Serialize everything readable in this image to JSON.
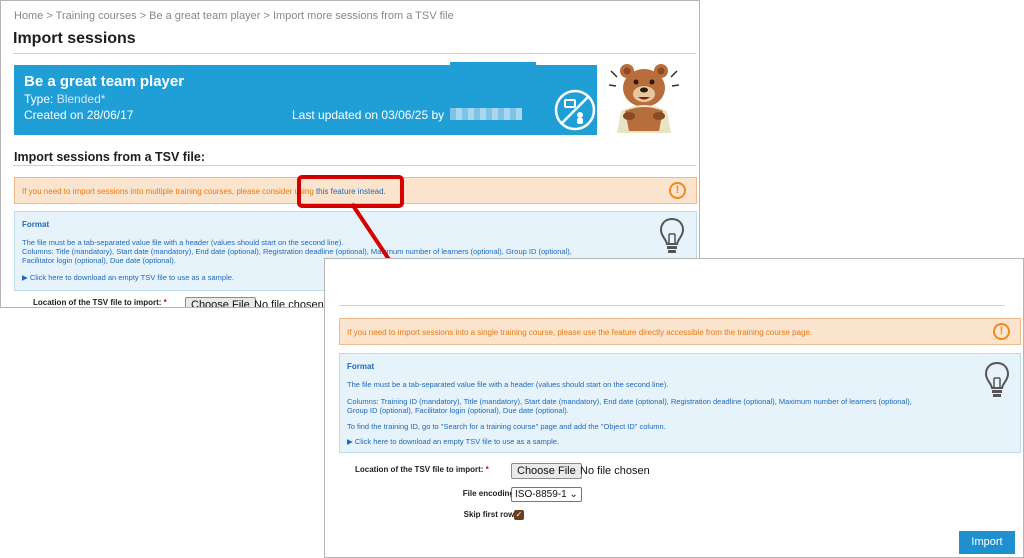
{
  "window1": {
    "breadcrumb": "Home > Training courses > Be a great team player > Import more sessions from a TSV file",
    "page_title": "Import sessions",
    "banner": {
      "title": "Be a great team player",
      "type_label": "Type:",
      "type_value": "Blended*",
      "created": "Created on 28/06/17",
      "last_updated": "Last updated on 03/06/25 by",
      "accent_color": "#1f9fd6"
    },
    "section_title": "Import sessions from a TSV file:",
    "warning": {
      "text": "If you need to import sessions into multiple training courses, please consider using",
      "link": "this feature instead."
    },
    "format": {
      "title": "Format",
      "line1": "The file must be a tab-separated value file with a header (values should start on the second line).",
      "line2": "Columns: Title (mandatory), Start date (mandatory), End date (optional), Registration deadline (optional), Maximum number of learners (optional), Group ID (optional),",
      "line3": "Facilitator login (optional), Due date (optional).",
      "download_link": "Click here to download an empty TSV file to use as a sample."
    },
    "file_label": "Location of the TSV file to import:",
    "required_mark": "*",
    "choose_file": "Choose File",
    "no_file": "No file chosen"
  },
  "window2": {
    "warning": {
      "text": "If you need to import sessions into a single training course, please use the feature directly accessible from the training course page."
    },
    "format": {
      "title": "Format",
      "line1": "The file must be a tab-separated value file with a header (values should start on the second line).",
      "line2": "Columns: Training ID (mandatory), Title (mandatory), Start date (mandatory), End date (optional), Registration deadline (optional), Maximum number of learners (optional),",
      "line3": "Group ID (optional), Facilitator login (optional), Due date (optional).",
      "line4": "To find the training ID, go to \"Search for a training course\" page and add the \"Object ID\" column.",
      "download_link": "Click here to download an empty TSV file to use as a sample."
    },
    "file_label": "Location of the TSV file to import:",
    "required_mark": "*",
    "choose_file": "Choose File",
    "no_file": "No file chosen",
    "encoding_label": "File encoding:",
    "encoding_value": "ISO-8859-1",
    "skip_label": "Skip first row:",
    "skip_checked": true,
    "import_button": "Import"
  },
  "colors": {
    "warning_bg": "#fbe4cd",
    "warning_text": "#e27c12",
    "info_bg": "#e7f3fa",
    "link": "#2069b5",
    "highlight": "#d40000",
    "import_button": "#1f90cf"
  },
  "icons": [
    "blended-learning-icon",
    "bear-mascot",
    "alert-circle-icon",
    "lightbulb-icon",
    "triangle-right-icon",
    "checkmark-icon",
    "chevron-down-icon"
  ]
}
